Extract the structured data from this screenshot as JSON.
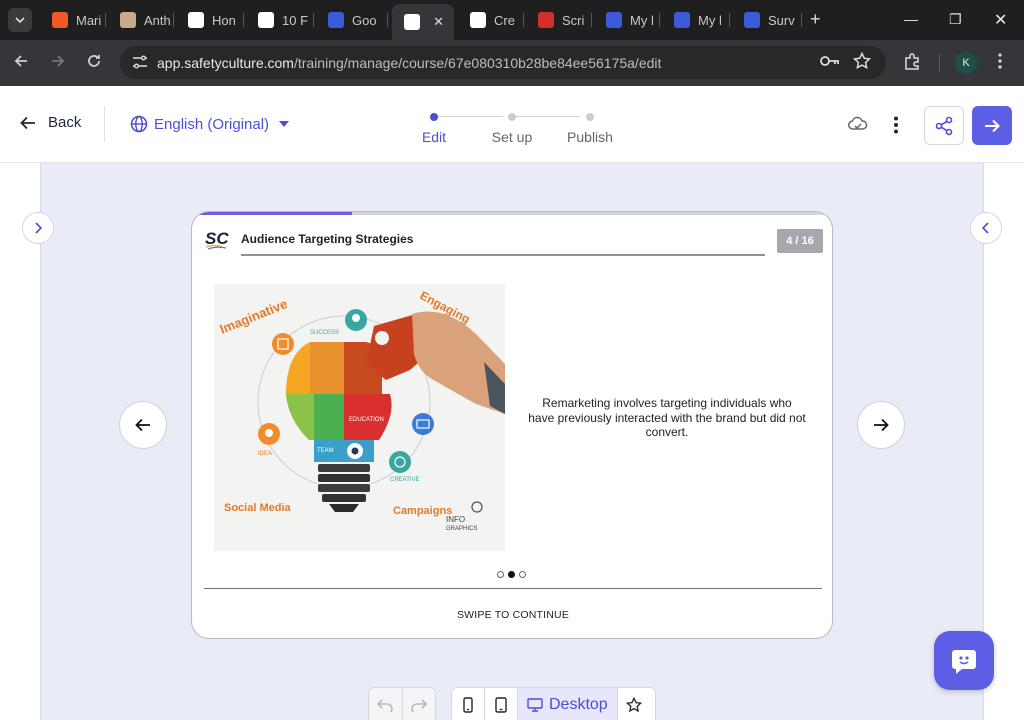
{
  "browser": {
    "tabs": [
      {
        "title": "Mari",
        "favicon_color": "#f05a28"
      },
      {
        "title": "Anth",
        "favicon_color": "#c9a98a"
      },
      {
        "title": "Hon",
        "favicon_color": "#ffffff"
      },
      {
        "title": "10 F",
        "favicon_color": "#ffffff"
      },
      {
        "title": "Goo",
        "favicon_color": "#3b5bdb"
      },
      {
        "title": "",
        "favicon_color": "#ffffff",
        "active": true
      },
      {
        "title": "Cre",
        "favicon_color": "#ffffff"
      },
      {
        "title": "Scri",
        "favicon_color": "#d32f2f"
      },
      {
        "title": "My l",
        "favicon_color": "#3b5bdb"
      },
      {
        "title": "My l",
        "favicon_color": "#3b5bdb"
      },
      {
        "title": "Surv",
        "favicon_color": "#3b5bdb"
      }
    ],
    "url_host": "app.safetyculture.com",
    "url_path": "/training/manage/course/67e080310b28be84ee56175a/edit",
    "profile_initial": "K"
  },
  "header": {
    "back_label": "Back",
    "language_label": "English (Original)",
    "steps": [
      {
        "label": "Edit",
        "active": true
      },
      {
        "label": "Set up",
        "active": false
      },
      {
        "label": "Publish",
        "active": false
      }
    ]
  },
  "slide": {
    "title": "Audience Targeting Strategies",
    "counter": "4 / 16",
    "progress": 0.25,
    "logo_text": "SC",
    "body": "Remarketing involves targeting individuals who have previously interacted with the brand but did not convert.",
    "carousel_total": 3,
    "carousel_active": 1,
    "swipe_label": "SWIPE TO CONTINUE",
    "illustration": {
      "imaginative": "Imaginative",
      "engaging": "Engaging",
      "social_media": "Social Media",
      "campaigns": "Campaigns",
      "success": "SUCCESS",
      "education": "EDUCATION",
      "team": "TEAM",
      "idea": "IDEA",
      "creative": "CREATIVE",
      "info": "INFO",
      "graphics": "GRAPHICS"
    }
  },
  "bottom": {
    "device_label": "Desktop"
  },
  "colors": {
    "accent": "#5c5fe6",
    "link": "#4b4fd1",
    "canvas": "#e9ebf6"
  }
}
